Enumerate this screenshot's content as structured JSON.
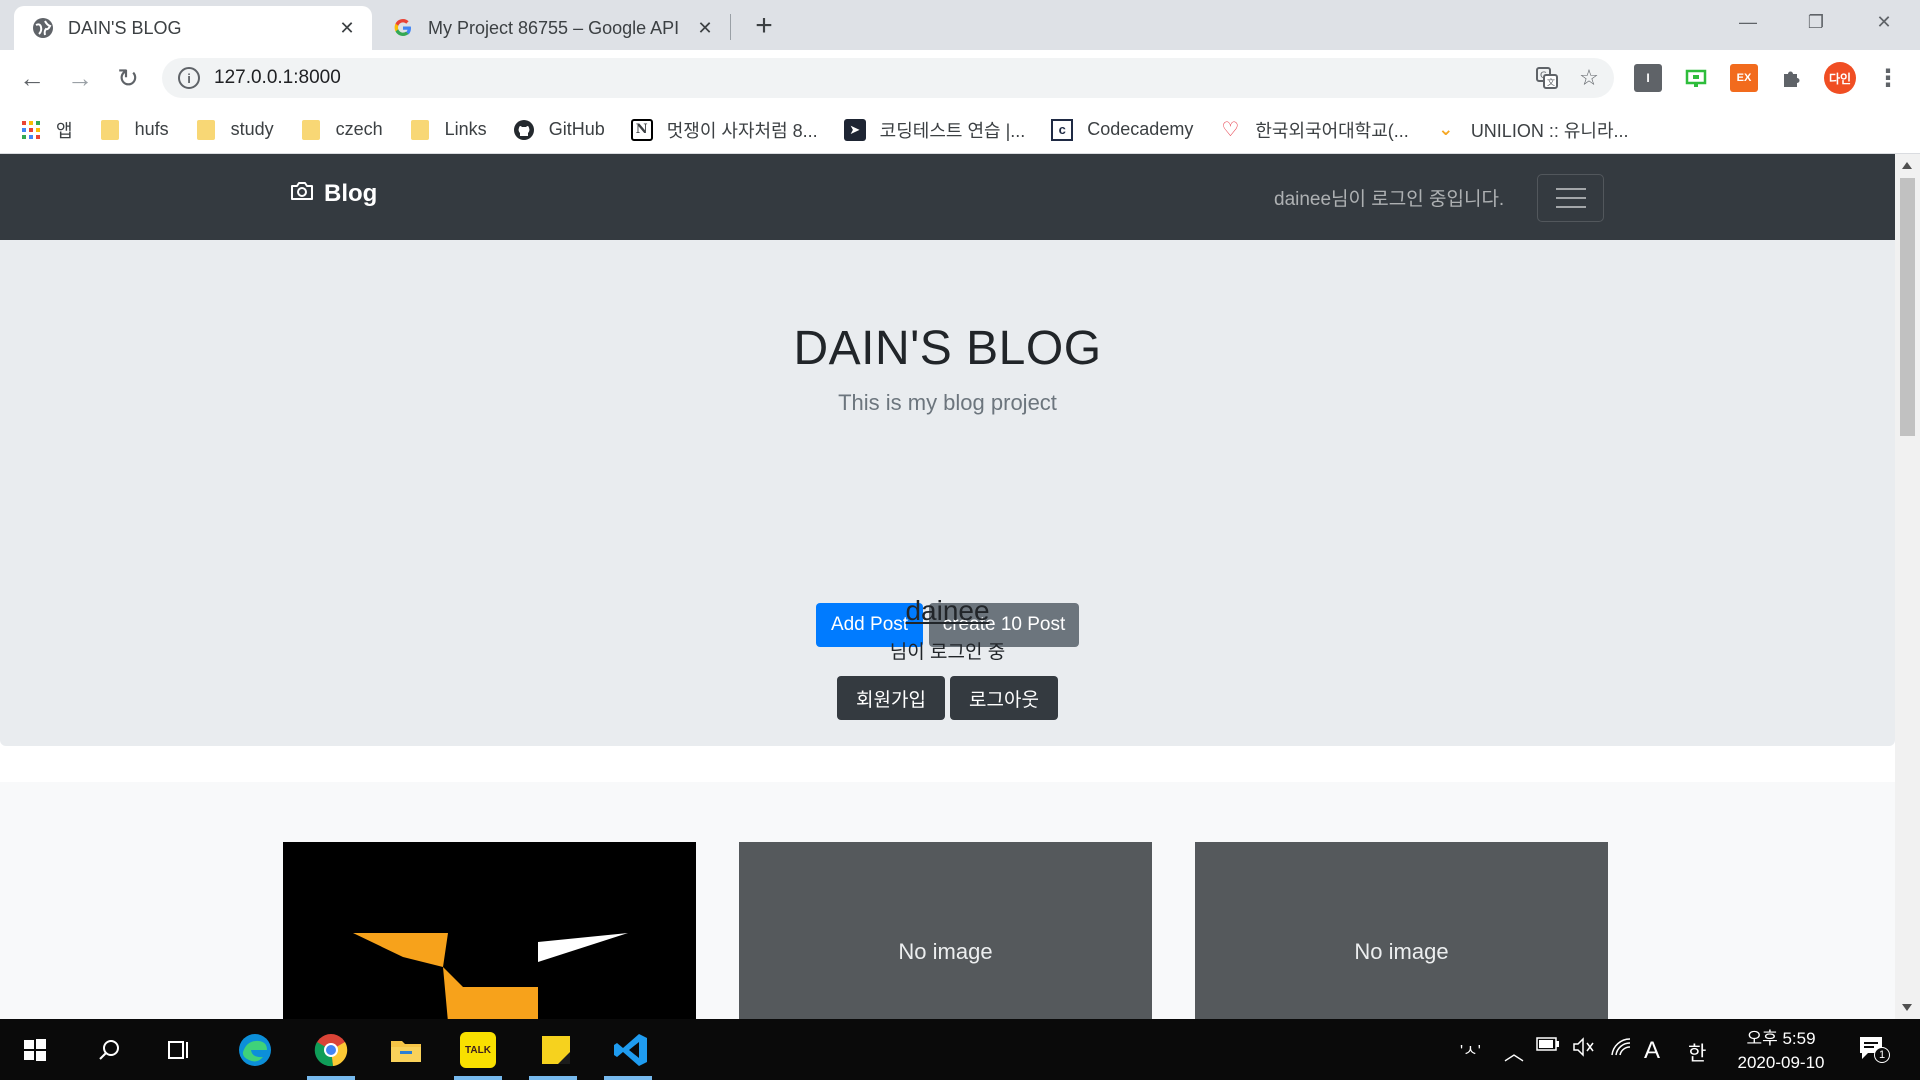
{
  "browser": {
    "tabs": [
      {
        "title": "DAIN'S BLOG",
        "active": true
      },
      {
        "title": "My Project 86755 – Google API",
        "active": false
      }
    ],
    "url": "127.0.0.1:8000",
    "profile_label": "다인",
    "ext_label": "EX"
  },
  "bookmarks": [
    {
      "label": "앱",
      "icon": "apps-grid-icon"
    },
    {
      "label": "hufs",
      "icon": "folder-icon"
    },
    {
      "label": "study",
      "icon": "folder-icon"
    },
    {
      "label": "czech",
      "icon": "folder-icon"
    },
    {
      "label": "Links",
      "icon": "folder-icon"
    },
    {
      "label": "GitHub",
      "icon": "github-icon"
    },
    {
      "label": "멋쟁이 사자처럼 8...",
      "icon": "notion-icon"
    },
    {
      "label": "코딩테스트 연습 |...",
      "icon": "programmers-icon"
    },
    {
      "label": "Codecademy",
      "icon": "codecademy-icon"
    },
    {
      "label": "한국외국어대학교(...",
      "icon": "hufs-heart-icon"
    },
    {
      "label": "UNILION :: 유니라...",
      "icon": "unilion-icon"
    }
  ],
  "site": {
    "brand": "Blog",
    "login_status": "dainee님이 로그인 중입니다.",
    "jumbotron": {
      "title": "DAIN'S BLOG",
      "lead": "This is my blog project",
      "add_post": "Add Post",
      "create_posts": "create 10 Post",
      "signup": "회원가입",
      "logout": "로그아웃",
      "username": "dainee",
      "user_status": "님이 로그인 중"
    },
    "cards": [
      {
        "type": "image"
      },
      {
        "type": "placeholder",
        "label": "No image"
      },
      {
        "type": "placeholder",
        "label": "No image"
      }
    ]
  },
  "taskbar": {
    "time": "오후 5:59",
    "date": "2020-09-10",
    "ime_mode": "한",
    "ime_letter": "A",
    "ime_hint": "'ㅅ'",
    "notification_count": "1",
    "talk_label": "TALK"
  }
}
